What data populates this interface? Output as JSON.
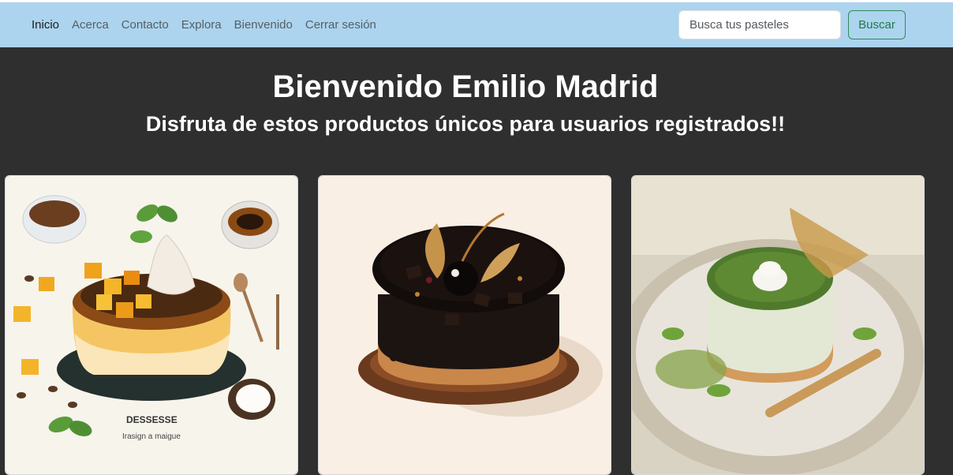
{
  "navbar": {
    "links": [
      "Inicio",
      "Acerca",
      "Contacto",
      "Explora",
      "Bienvenido",
      "Cerrar sesión"
    ],
    "search_placeholder": "Busca tus pasteles",
    "search_button": "Buscar"
  },
  "hero": {
    "title": "Bienvenido Emilio Madrid",
    "subtitle": "Disfruta de estos productos únicos para usuarios registrados!!"
  },
  "products": [
    {
      "image_text_1": "DESSESSE",
      "image_text_2": "Irasign a maigue"
    },
    {},
    {}
  ]
}
